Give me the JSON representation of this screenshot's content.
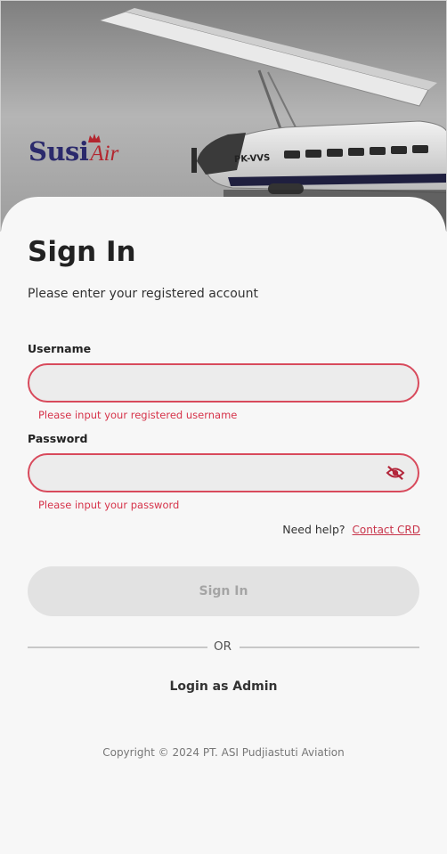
{
  "hero": {
    "plane_registration": "PK-VVS",
    "brand": {
      "name_part1": "Susi",
      "name_part2": "Air"
    }
  },
  "signin": {
    "title": "Sign In",
    "subtitle": "Please enter your registered account"
  },
  "username": {
    "label": "Username",
    "value": "",
    "placeholder": "",
    "error": "Please input your registered username"
  },
  "password": {
    "label": "Password",
    "value": "",
    "placeholder": "",
    "error": "Please input your password",
    "toggle_icon": "eye-off-icon"
  },
  "help": {
    "text": "Need help?",
    "link": "Contact CRD"
  },
  "buttons": {
    "signin": "Sign In",
    "or": "OR",
    "admin": "Login as Admin"
  },
  "footer": {
    "copyright": "Copyright © 2024 PT. ASI Pudjiastuti Aviation"
  },
  "colors": {
    "error": "#d6334a",
    "brand_blue": "#2b2a6c",
    "brand_red": "#b3262f"
  }
}
